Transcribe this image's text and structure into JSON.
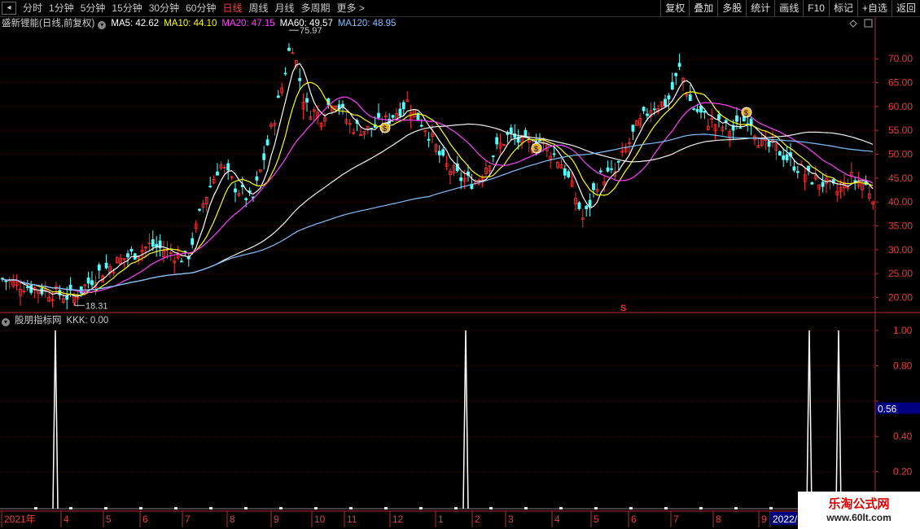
{
  "topbar": {
    "back_icon": "square-arrow-icon",
    "tabs": [
      {
        "label": "分时",
        "active": false
      },
      {
        "label": "1分钟",
        "active": false
      },
      {
        "label": "5分钟",
        "active": false
      },
      {
        "label": "15分钟",
        "active": false
      },
      {
        "label": "30分钟",
        "active": false
      },
      {
        "label": "60分钟",
        "active": false
      },
      {
        "label": "日线",
        "active": true
      },
      {
        "label": "周线",
        "active": false
      },
      {
        "label": "月线",
        "active": false
      },
      {
        "label": "多周期",
        "active": false
      },
      {
        "label": "更多 >",
        "active": false
      }
    ],
    "right_buttons": [
      "复权",
      "叠加",
      "多股",
      "统计",
      "画线",
      "F10",
      "标记",
      "+自选",
      "返回"
    ]
  },
  "main_legend": {
    "title": "盛新锂能(日线,前复权)",
    "ma5": "MA5: 42.62",
    "ma10": "MA10: 44.10",
    "ma20": "MA20: 47.15",
    "ma60": "MA60: 49.57",
    "ma120": "MA120: 48.95",
    "colors": {
      "ma5": "#ffffff",
      "ma10": "#ffff00",
      "ma20": "#ff40ff",
      "ma60": "#ffffff",
      "ma120": "#80c0ff"
    }
  },
  "price_labels": {
    "high": "75.97",
    "low": "18.31"
  },
  "price_axis": [
    "70.00",
    "65.00",
    "60.00",
    "55.00",
    "50.00",
    "45.00",
    "40.00",
    "35.00",
    "30.00",
    "25.00",
    "20.00"
  ],
  "indicator_legend": {
    "title": "股朋指标网",
    "kkk": "KKK: 0.00"
  },
  "indicator_axis": [
    "1.00",
    "0.80",
    "0.60",
    "0.40",
    "0.20"
  ],
  "indicator_cursor": "0.56",
  "time_axis": [
    "2021年",
    "4",
    "5",
    "6",
    "7",
    "8",
    "9",
    "10",
    "11",
    "12",
    "1",
    "2",
    "3",
    "4",
    "5",
    "6",
    "7",
    "8",
    "9",
    "2022/"
  ],
  "signal_marker": "S",
  "watermark": {
    "line1": "乐淘公式网",
    "line2": "www.60lt.com"
  }
}
